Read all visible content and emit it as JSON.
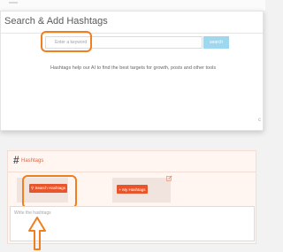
{
  "modal": {
    "title": "Search & Add Hashtags",
    "keyword_placeholder": "Enter a keyword",
    "search_label": "search",
    "helper_text": "Hashtags help our AI to find the best targets for growth, posts and other tools"
  },
  "panel": {
    "title": "Hashtags",
    "search_hashtags_label": "Search Hashtags",
    "my_hashtags_label": "+ My Hashtags",
    "textarea_placeholder": "Write the hashtags"
  },
  "icons": {
    "hash": "hash-icon",
    "search": "search-icon",
    "edit": "edit-icon",
    "arrow": "up-arrow-icon"
  },
  "colors": {
    "accent": "#e9552a",
    "highlight": "#f07f1e",
    "search_button": "#9fd8ee",
    "panel_bg": "#fff5f1"
  }
}
